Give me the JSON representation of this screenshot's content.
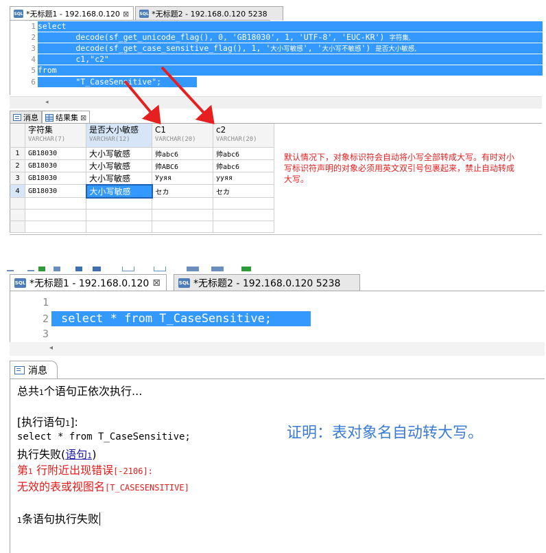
{
  "top": {
    "tabs": [
      {
        "label": "*无标题1 - 192.168.0.120",
        "close": "⊠",
        "active": true
      },
      {
        "label": "*无标题2 - 192.168.0.120 5238",
        "active": false
      }
    ],
    "code": [
      {
        "n": "1",
        "text": "select"
      },
      {
        "n": "2",
        "pre": "        decode(sf_get_unicode_flag(), 0, 'GB18030', 1, 'UTF-8', 'EUC-KR') ",
        "cjk": "字符集,"
      },
      {
        "n": "3",
        "pre": "        decode(sf_get_case_sensitive_flag(), 1, '",
        "cjk1": "大小写敏感",
        "mid": "', '",
        "cjk2": "大小写不敏感",
        "post": "') ",
        "cjk3": "是否大小敏感,"
      },
      {
        "n": "4",
        "text": "        c1,\"c2\""
      },
      {
        "n": "5",
        "text": "from"
      },
      {
        "n": "6",
        "text": "        \"T_CaseSensitive\";"
      }
    ],
    "scroll_arrow": "◂",
    "results_tabs": [
      {
        "label": "消息"
      },
      {
        "label": "结果集",
        "close": "⊠"
      }
    ],
    "columns": [
      {
        "name": "字符集",
        "type": "VARCHAR(7)"
      },
      {
        "name": "是否大小敏感",
        "type": "VARCHAR(12)"
      },
      {
        "name": "C1",
        "type": "VARCHAR(20)"
      },
      {
        "name": "c2",
        "type": "VARCHAR(20)"
      }
    ],
    "rows": [
      {
        "n": "1",
        "cells": [
          "GB18030",
          "大小写敏感",
          "帅abc6",
          "帅abc6"
        ]
      },
      {
        "n": "2",
        "cells": [
          "GB18030",
          "大小写敏感",
          "帅ABC6",
          "帅abc6"
        ]
      },
      {
        "n": "3",
        "cells": [
          "GB18030",
          "大小写敏感",
          "Ууяя",
          "ууяя"
        ]
      },
      {
        "n": "4",
        "cells": [
          "GB18030",
          "大小写敏感",
          "セカ",
          "セカ"
        ]
      }
    ],
    "note": "默认情况下，对象标识符会自动将小写全部转成大写。有时对小写标识符声明的对象必须用英文双引号包裹起来，禁止自动转成大写。"
  },
  "bottom": {
    "tabs": [
      {
        "label": "*无标题1 - 192.168.0.120",
        "close": "⊠",
        "active": true
      },
      {
        "label": "*无标题2 - 192.168.0.120 5238",
        "active": false
      }
    ],
    "code": [
      {
        "n": "1",
        "text": ""
      },
      {
        "n": "2",
        "text": "select * from T_CaseSensitive;"
      },
      {
        "n": "3",
        "text": ""
      }
    ],
    "scroll_arrow": "◂",
    "msg_tab": "消息",
    "messages": {
      "line1_a": "总共",
      "line1_n": "1",
      "line1_b": "个语句正依次执行...",
      "line2_a": "[执行语句",
      "line2_n": "1",
      "line2_b": "]:",
      "line3": "select * from T_CaseSensitive;",
      "line4_a": "执行失败(",
      "line4_link": "语句",
      "line4_n": "1",
      "line4_b": ")",
      "line5_a": "第",
      "line5_n": "1",
      "line5_b": " 行附近出现错误",
      "line5_c": "[-2106]:",
      "line6_a": "无效的表或视图名",
      "line6_b": "[T_CASESENSITIVE]",
      "line7_n": "1",
      "line7_b": "条语句执行失败"
    },
    "proof": "证明：表对象名自动转大写。"
  },
  "icons": {
    "sql": "SQL"
  },
  "colors": {
    "selection": "#3399ff",
    "annotation_red": "#e62020",
    "proof_blue": "#3a7bd5"
  }
}
